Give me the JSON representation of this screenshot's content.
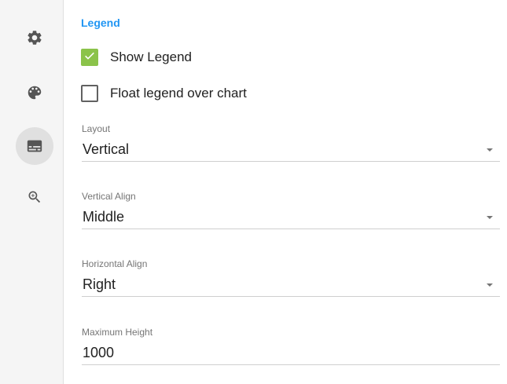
{
  "sidebar": {
    "items": [
      {
        "icon": "gear-icon",
        "active": false
      },
      {
        "icon": "palette-icon",
        "active": false
      },
      {
        "icon": "legend-icon",
        "active": true
      },
      {
        "icon": "zoom-in-icon",
        "active": false
      }
    ]
  },
  "legend": {
    "section_title": "Legend",
    "show_legend": {
      "label": "Show Legend",
      "checked": true
    },
    "float_legend": {
      "label": "Float legend over chart",
      "checked": false
    },
    "layout": {
      "label": "Layout",
      "value": "Vertical"
    },
    "vertical_align": {
      "label": "Vertical Align",
      "value": "Middle"
    },
    "horizontal_align": {
      "label": "Horizontal Align",
      "value": "Right"
    },
    "max_height": {
      "label": "Maximum Height",
      "value": "1000"
    }
  },
  "colors": {
    "accent": "#2196f3",
    "checkbox_checked": "#8bc34a",
    "sidebar_bg": "#f5f5f5"
  }
}
